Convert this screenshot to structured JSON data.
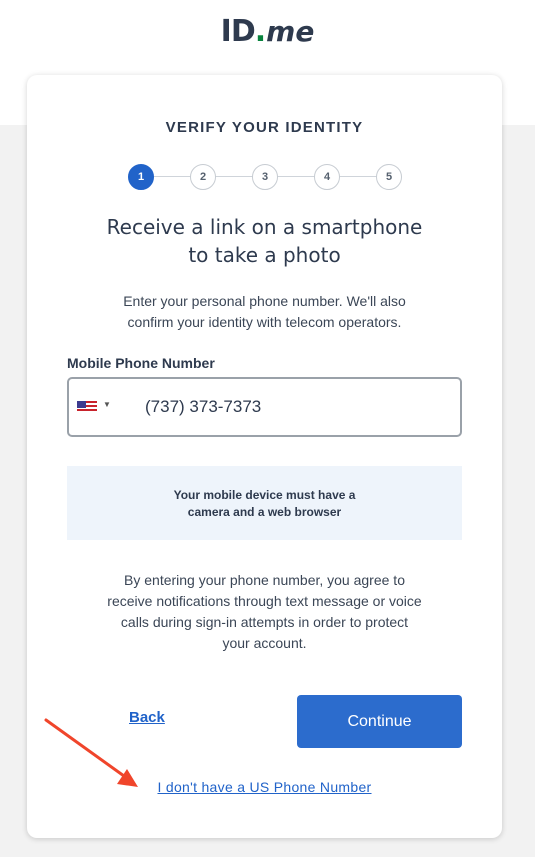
{
  "brand": {
    "logo_id": "ID",
    "logo_dot": ".",
    "logo_me": "me"
  },
  "header": {
    "eyebrow": "VERIFY YOUR IDENTITY"
  },
  "stepper": {
    "steps": [
      "1",
      "2",
      "3",
      "4",
      "5"
    ],
    "current": 1
  },
  "main": {
    "title_line1": "Receive a link on a smartphone",
    "title_line2": "to take a photo",
    "subtext_line1": "Enter your personal phone number. We'll also",
    "subtext_line2": "confirm your identity with telecom operators."
  },
  "phone_field": {
    "label": "Mobile Phone Number",
    "country": "US",
    "value": "(737) 373-7373"
  },
  "notice": {
    "line1": "Your mobile device must have a",
    "line2": "camera and a web browser"
  },
  "consent": {
    "line1": "By entering your phone number, you agree to",
    "line2": "receive notifications through text message or voice",
    "line3": "calls during sign-in attempts in order to protect",
    "line4": "your account."
  },
  "actions": {
    "back_label": "Back",
    "continue_label": "Continue",
    "no_us_label": "I don't have a US Phone Number"
  },
  "colors": {
    "primary": "#2c6ccd",
    "link": "#2163c9",
    "brand_green": "#08833d",
    "annotation": "#f0452b"
  }
}
